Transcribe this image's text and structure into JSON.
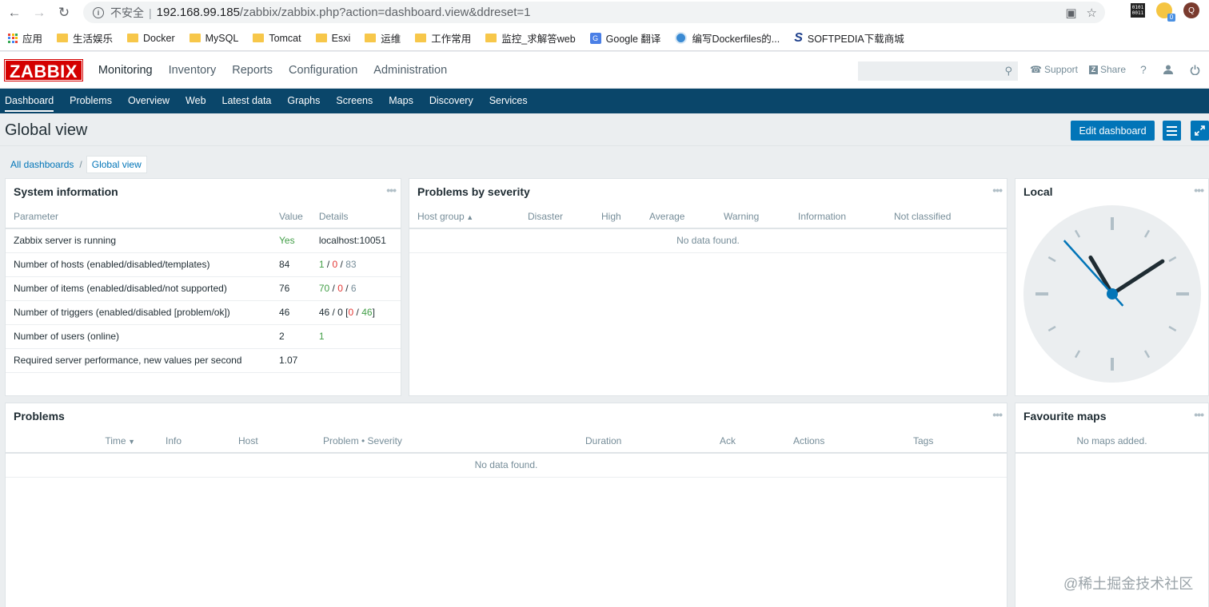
{
  "browser": {
    "insecure_label": "不安全",
    "url_host": "192.168.99.185",
    "url_path": "/zabbix/zabbix.php?action=dashboard.view&ddreset=1",
    "ext_badge": "0",
    "avatar_letter": "Q",
    "bookmarks": [
      {
        "label": "应用",
        "icon": "apps-grid-icon"
      },
      {
        "label": "生活娱乐",
        "icon": "folder-icon"
      },
      {
        "label": "Docker",
        "icon": "folder-icon"
      },
      {
        "label": "MySQL",
        "icon": "folder-icon"
      },
      {
        "label": "Tomcat",
        "icon": "folder-icon"
      },
      {
        "label": "Esxi",
        "icon": "folder-icon"
      },
      {
        "label": "运维",
        "icon": "folder-icon"
      },
      {
        "label": "工作常用",
        "icon": "folder-icon"
      },
      {
        "label": "监控_求解答web",
        "icon": "folder-icon"
      },
      {
        "label": "Google 翻译",
        "icon": "google-translate-icon"
      },
      {
        "label": "编写Dockerfiles的...",
        "icon": "site-icon"
      },
      {
        "label": "SOFTPEDIA下载商城",
        "icon": "softpedia-icon"
      }
    ]
  },
  "header": {
    "logo": "ZABBIX",
    "menu": [
      "Monitoring",
      "Inventory",
      "Reports",
      "Configuration",
      "Administration"
    ],
    "support": "Support",
    "share": "Share",
    "help": "?"
  },
  "submenu": [
    "Dashboard",
    "Problems",
    "Overview",
    "Web",
    "Latest data",
    "Graphs",
    "Screens",
    "Maps",
    "Discovery",
    "Services"
  ],
  "page": {
    "title": "Global view",
    "edit_button": "Edit dashboard",
    "breadcrumb": {
      "parent": "All dashboards",
      "sep": "/",
      "current": "Global view"
    }
  },
  "system_info": {
    "title": "System information",
    "columns": [
      "Parameter",
      "Value",
      "Details"
    ],
    "rows": [
      {
        "param": "Zabbix server is running",
        "value": "Yes",
        "details": "localhost:10051"
      },
      {
        "param": "Number of hosts (enabled/disabled/templates)",
        "value": "84",
        "d1": "1",
        "d2": "0",
        "d3": "83"
      },
      {
        "param": "Number of items (enabled/disabled/not supported)",
        "value": "76",
        "d1": "70",
        "d2": "0",
        "d3": "6"
      },
      {
        "param": "Number of triggers (enabled/disabled [problem/ok])",
        "value": "46",
        "t1": "46 / 0 [",
        "t2": "0",
        "t3": " / ",
        "t4": "46",
        "t5": "]"
      },
      {
        "param": "Number of users (online)",
        "value": "2",
        "details": "1"
      },
      {
        "param": "Required server performance, new values per second",
        "value": "1.07",
        "details": ""
      }
    ]
  },
  "severity": {
    "title": "Problems by severity",
    "columns": [
      "Host group",
      "Disaster",
      "High",
      "Average",
      "Warning",
      "Information",
      "Not classified"
    ],
    "empty": "No data found."
  },
  "clock": {
    "title": "Local",
    "hour": 1,
    "minute": 54,
    "second": 53
  },
  "problems": {
    "title": "Problems",
    "columns": [
      "Time",
      "Info",
      "Host",
      "Problem • Severity",
      "Duration",
      "Ack",
      "Actions",
      "Tags"
    ],
    "empty": "No data found."
  },
  "maps": {
    "title": "Favourite maps",
    "empty": "No maps added."
  },
  "watermark": "@稀土掘金技术社区",
  "colors": {
    "brand": "#d40000",
    "nav": "#0a466a",
    "accent": "#0275b8",
    "ok": "#429e47",
    "problem": "#e33734"
  }
}
